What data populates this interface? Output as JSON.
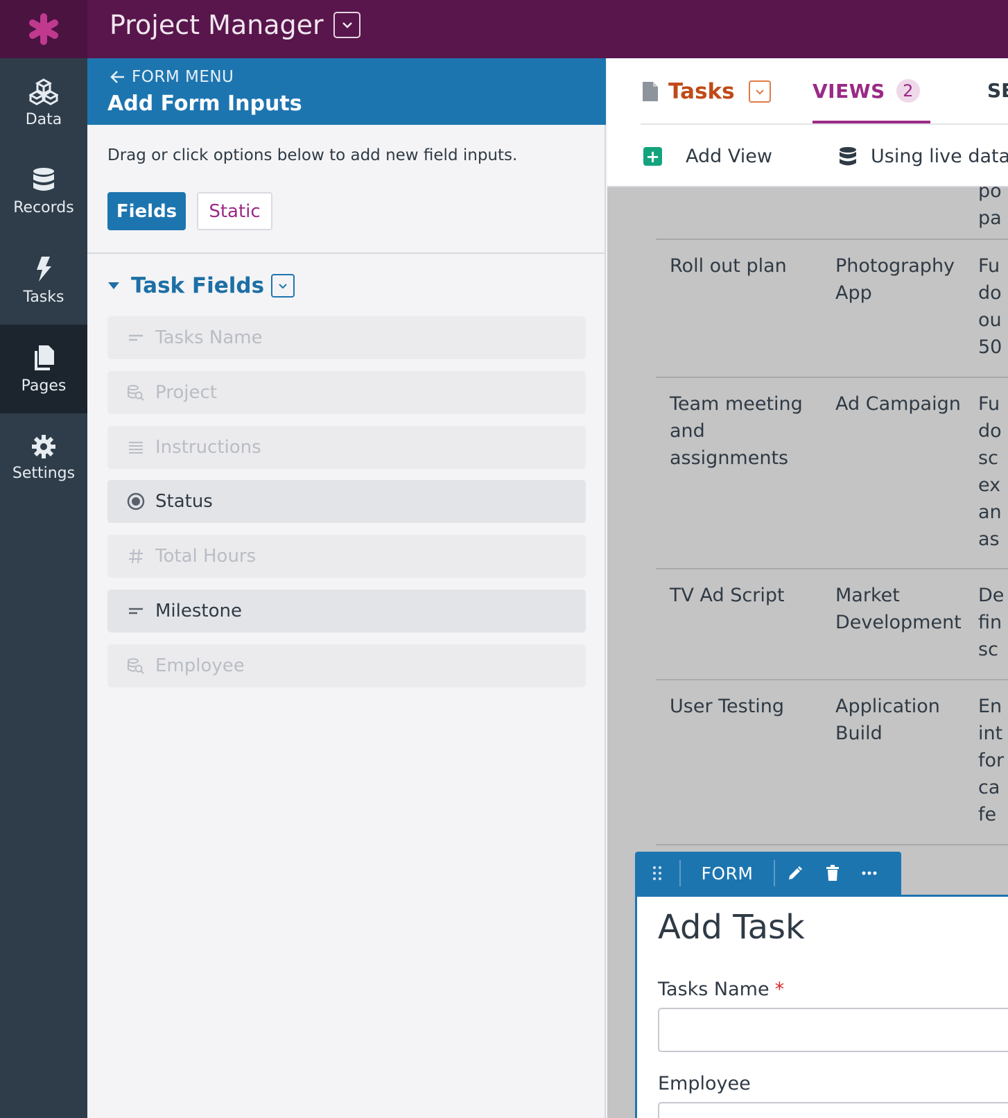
{
  "app": {
    "title": "Project Manager"
  },
  "nav": [
    {
      "id": "data",
      "label": "Data",
      "icon": "cubes-icon"
    },
    {
      "id": "records",
      "label": "Records",
      "icon": "database-icon"
    },
    {
      "id": "tasks",
      "label": "Tasks",
      "icon": "lightning-icon"
    },
    {
      "id": "pages",
      "label": "Pages",
      "icon": "pages-icon",
      "active": true
    },
    {
      "id": "settings",
      "label": "Settings",
      "icon": "gear-icon"
    }
  ],
  "form_menu": {
    "back_label": "FORM MENU",
    "title": "Add Form Inputs",
    "hint": "Drag or click options below to add new field inputs.",
    "tabs": {
      "fields": "Fields",
      "static": "Static",
      "active": "Fields"
    },
    "section": {
      "title": "Task Fields",
      "fields": [
        {
          "label": "Tasks Name",
          "icon": "short-text-icon",
          "enabled": false
        },
        {
          "label": "Project",
          "icon": "connection-icon",
          "enabled": false
        },
        {
          "label": "Instructions",
          "icon": "paragraph-icon",
          "enabled": false
        },
        {
          "label": "Status",
          "icon": "radio-icon",
          "enabled": true
        },
        {
          "label": "Total Hours",
          "icon": "number-icon",
          "enabled": false
        },
        {
          "label": "Milestone",
          "icon": "short-text-icon",
          "enabled": true
        },
        {
          "label": "Employee",
          "icon": "connection-icon",
          "enabled": false
        }
      ]
    }
  },
  "page_tabs": {
    "page_name": "Tasks",
    "views_label": "VIEWS",
    "views_count": "2",
    "next_tab_partial": "SE",
    "add_view": "Add View",
    "live_data": "Using live data"
  },
  "table_rows": [
    {
      "task": "",
      "project": "",
      "desc": "po\npa"
    },
    {
      "task": "Roll out plan",
      "project": "Photography App",
      "desc": "Fu\ndo\nou\n50"
    },
    {
      "task": "Team meeting and assignments",
      "project": "Ad Campaign",
      "desc": "Fu\ndo\nsc\nex\nan\nas"
    },
    {
      "task": "TV Ad Script",
      "project": "Market Development",
      "desc": "De\nfin\nsc"
    },
    {
      "task": "User Testing",
      "project": "Application Build",
      "desc": "En\nint\nfor\nca\nfe"
    }
  ],
  "form": {
    "toolbar_label": "FORM",
    "title": "Add Task",
    "field1_label": "Tasks Name",
    "field1_required": "*",
    "field2_label": "Employee"
  },
  "colors": {
    "topbar": "#58164c",
    "accent_blue": "#1d75b0",
    "accent_purple": "#9a2a85",
    "accent_orange": "#c04a18",
    "nav_bg": "#2f3d4a"
  }
}
